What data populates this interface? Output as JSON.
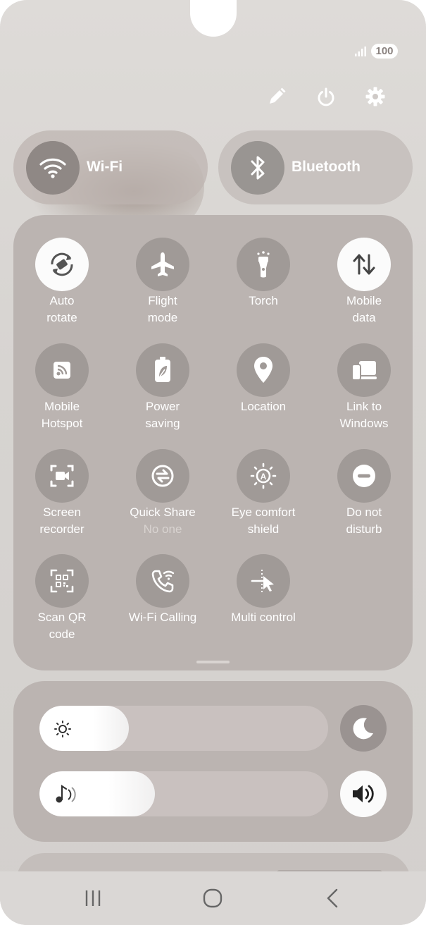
{
  "status_bar": {
    "battery": "100",
    "signal_icon": "signal-bars-icon"
  },
  "top_actions": [
    {
      "icon": "pencil-edit-icon"
    },
    {
      "icon": "power-icon"
    },
    {
      "icon": "gear-settings-icon"
    }
  ],
  "big_toggles": {
    "wifi": {
      "label": "Wi-Fi",
      "icon": "wifi-icon",
      "state": "on"
    },
    "bluetooth": {
      "label": "Bluetooth",
      "icon": "bluetooth-icon",
      "state": "off"
    }
  },
  "quick_tiles": [
    {
      "line1": "Auto",
      "line2": "rotate",
      "icon": "auto-rotate-icon",
      "on": true
    },
    {
      "line1": "Flight",
      "line2": "mode",
      "icon": "airplane-icon",
      "on": false
    },
    {
      "line1": "Torch",
      "line2": "",
      "icon": "flashlight-icon",
      "on": false
    },
    {
      "line1": "Mobile",
      "line2": "data",
      "icon": "mobile-data-icon",
      "on": true
    },
    {
      "line1": "Mobile",
      "line2": "Hotspot",
      "icon": "hotspot-icon",
      "on": false
    },
    {
      "line1": "Power",
      "line2": "saving",
      "icon": "battery-leaf-icon",
      "on": false
    },
    {
      "line1": "Location",
      "line2": "",
      "icon": "location-pin-icon",
      "on": false
    },
    {
      "line1": "Link to",
      "line2": "Windows",
      "icon": "link-to-windows-icon",
      "on": false
    },
    {
      "line1": "Screen",
      "line2": "recorder",
      "icon": "screen-recorder-icon",
      "on": false
    },
    {
      "line1": "Quick Share",
      "line2": "No one",
      "icon": "quick-share-icon",
      "on": false,
      "sub": true
    },
    {
      "line1": "Eye comfort",
      "line2": "shield",
      "icon": "eye-comfort-icon",
      "on": false
    },
    {
      "line1": "Do not",
      "line2": "disturb",
      "icon": "do-not-disturb-icon",
      "on": false
    },
    {
      "line1": "Scan QR",
      "line2": "code",
      "icon": "qr-scan-icon",
      "on": false
    },
    {
      "line1": "Wi-Fi Calling",
      "line2": "",
      "icon": "wifi-calling-icon",
      "on": false
    },
    {
      "line1": "Multi control",
      "line2": "",
      "icon": "multi-control-icon",
      "on": false
    }
  ],
  "sliders": {
    "brightness": {
      "level": 0.31,
      "icon": "sun-icon",
      "side_icon": "moon-dark-mode-icon"
    },
    "volume": {
      "level": 0.4,
      "icon": "music-note-icon",
      "side_icon": "speaker-volume-icon"
    }
  },
  "nav": [
    {
      "icon": "recents-icon"
    },
    {
      "icon": "home-icon"
    },
    {
      "icon": "back-icon"
    }
  ],
  "colors": {
    "panel": "#bbb4b1",
    "tile_off": "#a09a97",
    "tile_on": "#fbfbfb"
  }
}
